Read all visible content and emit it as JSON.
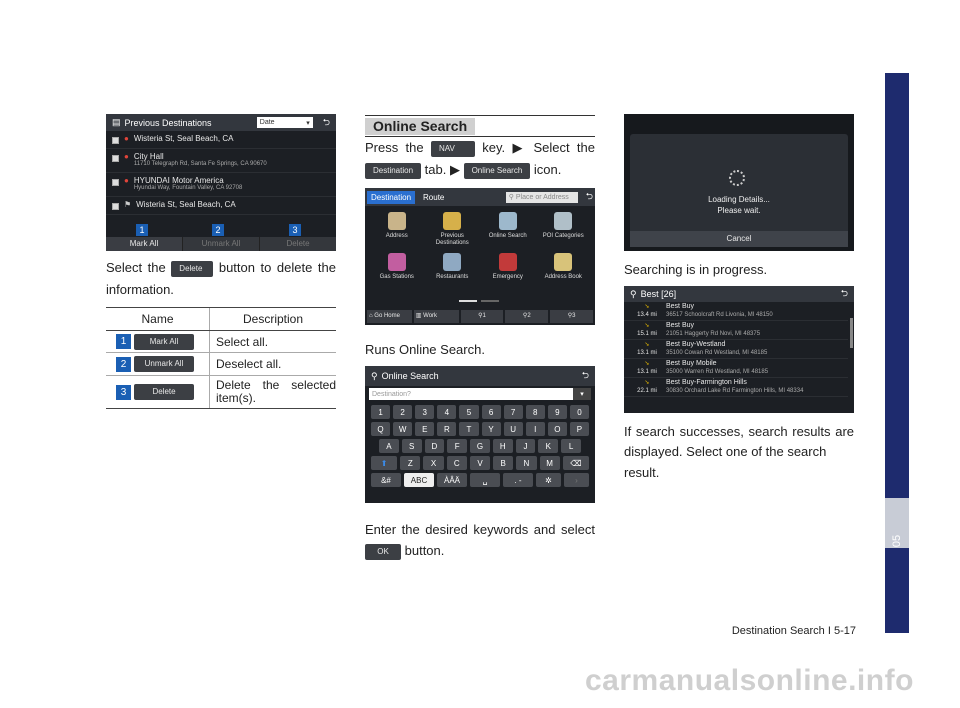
{
  "col1": {
    "screen": {
      "title": "Previous Destinations",
      "date_label": "Date",
      "items": [
        {
          "name": "Wisteria St, Seal Beach, CA",
          "addr": ""
        },
        {
          "name": "City Hall",
          "addr": "11710 Telegraph Rd, Santa Fe Springs, CA 90670"
        },
        {
          "name": "HYUNDAI Motor America",
          "addr": "Hyundai Way, Fountain Valley, CA 92708"
        },
        {
          "name": "Wisteria St, Seal Beach, CA",
          "addr": ""
        }
      ],
      "buttons": [
        "Mark All",
        "Unmark All",
        "Delete"
      ],
      "callouts": [
        "1",
        "2",
        "3"
      ]
    },
    "text_pre": "Select the",
    "delete_btn": "Delete",
    "text_post": "button to delete the",
    "text_line2": "information.",
    "table": {
      "head": [
        "Name",
        "Description"
      ],
      "rows": [
        {
          "num": "1",
          "btn": "Mark All",
          "desc": "Select all."
        },
        {
          "num": "2",
          "btn": "Unmark All",
          "desc": "Deselect all."
        },
        {
          "num": "3",
          "btn": "Delete",
          "desc1": "Delete the selected",
          "desc2": "item(s)."
        }
      ]
    }
  },
  "col2": {
    "heading": "Online Search",
    "p1a": "Press the",
    "nav_key": "NAV",
    "p1b": "key. ▶ Select the",
    "dest_tab": "Destination",
    "p1c": "tab. ▶",
    "online_icon": "Online Search",
    "p1d": "icon.",
    "nav_screen": {
      "tabs": [
        "Destination",
        "Route"
      ],
      "search_ph": "Place or Address",
      "cells": [
        "Address",
        "Previous Destinations",
        "Online Search",
        "POI Categories",
        "Gas Stations",
        "Restaurants",
        "Emergency",
        "Address Book"
      ],
      "bottom": [
        "Go Home",
        "Work",
        "1",
        "2",
        "3"
      ]
    },
    "caption1": "Runs Online Search.",
    "kb_screen": {
      "title": "Online Search",
      "placeholder": "Destination?",
      "row1": [
        "1",
        "2",
        "3",
        "4",
        "5",
        "6",
        "7",
        "8",
        "9",
        "0"
      ],
      "row2": [
        "Q",
        "W",
        "E",
        "R",
        "T",
        "Y",
        "U",
        "I",
        "O",
        "P"
      ],
      "row3": [
        "A",
        "S",
        "D",
        "F",
        "G",
        "H",
        "J",
        "K",
        "L"
      ],
      "row4": [
        "Z",
        "X",
        "C",
        "V",
        "B",
        "N",
        "M"
      ],
      "row5": [
        "&#",
        "ABC",
        "ÀÂÄ",
        ". -"
      ]
    },
    "caption2": "Enter the desired keywords and select the",
    "ok_btn": "OK",
    "caption2b": "button."
  },
  "col3": {
    "loading": {
      "line1": "Loading Details...",
      "line2": "Please wait.",
      "cancel": "Cancel"
    },
    "caption1": "Searching is in progress.",
    "results": {
      "title": "Best [26]",
      "rows": [
        {
          "dist": "13.4 mi",
          "name": "Best Buy",
          "addr": "36517 Schoolcraft Rd Livonia, MI 48150"
        },
        {
          "dist": "15.1 mi",
          "name": "Best Buy",
          "addr": "21051 Haggerty Rd Novi, MI 48375"
        },
        {
          "dist": "13.1 mi",
          "name": "Best Buy-Westland",
          "addr": "35100 Cowan Rd Westland, MI 48185"
        },
        {
          "dist": "13.1 mi",
          "name": "Best Buy Mobile",
          "addr": "35000 Warren Rd Westland, MI 48185"
        },
        {
          "dist": "22.1 mi",
          "name": "Best Buy-Farmington Hills",
          "addr": "30830 Orchard Lake Rd Farmington Hills, MI 48334"
        }
      ]
    },
    "p1": "If search successes, search results are",
    "p2": "displayed. Select one of the search result."
  },
  "footer": "Destination Search I 5-17",
  "side_tab": "05",
  "watermark": "carmanualsonline.info"
}
